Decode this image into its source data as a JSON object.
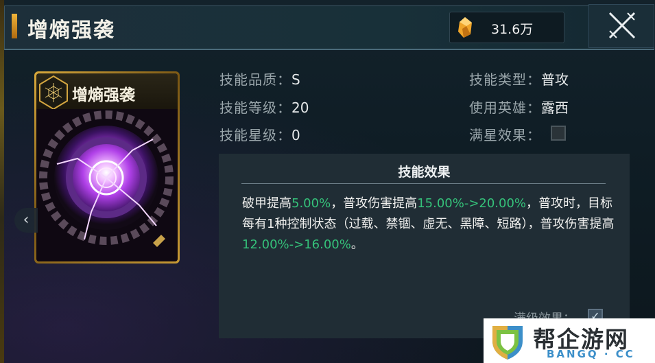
{
  "header": {
    "title": "增熵强袭",
    "currency_value": "31.6万",
    "currency_icon": "crystal-icon",
    "close_icon": "crossed-swords-close-icon"
  },
  "card": {
    "name": "增熵强袭",
    "emblem_icon": "web-hex-icon",
    "prev_arrow": "‹"
  },
  "info": {
    "quality_label": "技能品质：",
    "quality_value": "S",
    "level_label": "技能等级：",
    "level_value": "20",
    "star_label": "技能星级：",
    "star_value": "0",
    "type_label": "技能类型：",
    "type_value": "普攻",
    "hero_label": "使用英雄：",
    "hero_value": "露西",
    "max_star_label": "满星效果：",
    "max_star_checked": false
  },
  "effect": {
    "title": "技能效果",
    "seg1": "破甲提高",
    "seg2": "5.00%",
    "seg3": "，普攻伤害提高",
    "seg4": "15.00%->20.00%",
    "seg5": "，普攻时，目标每有1种控制状态（过载、禁锢、虚无、黑障、短路），普攻伤害提高",
    "seg6": "12.00%->16.00%",
    "seg7": "。",
    "highlight_color": "#35c27a",
    "max_level_label": "满级效果：",
    "max_level_checked": true
  },
  "watermark": {
    "cn": "帮企游网",
    "en": "BANGQ · CC"
  }
}
